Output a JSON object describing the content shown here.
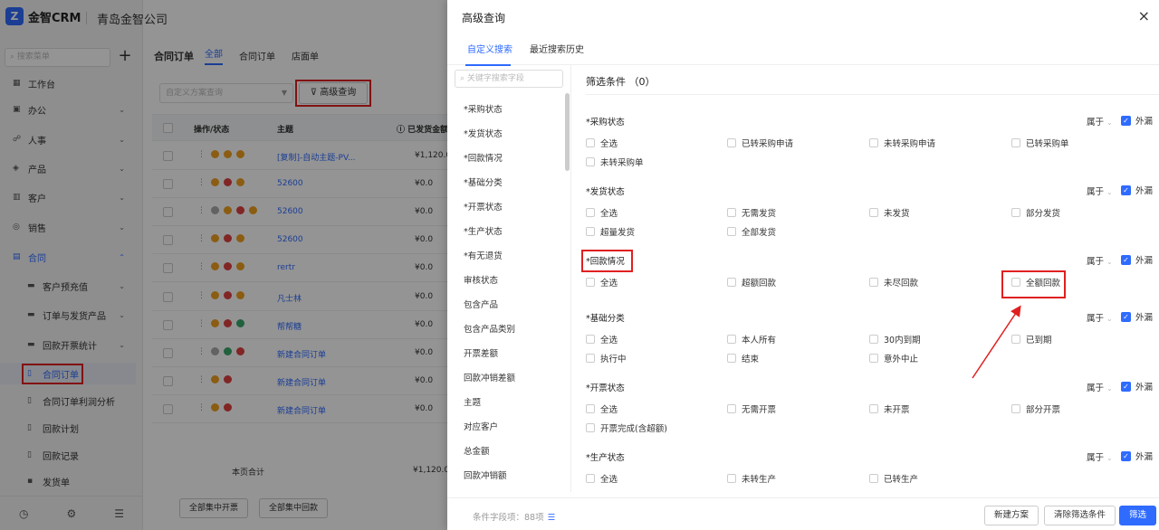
{
  "app": {
    "logo_mark": "Z",
    "logo_text": "金智CRM",
    "company": "青岛金智公司"
  },
  "sidebar": {
    "search_placeholder": "搜索菜单",
    "add_label": "+",
    "items": [
      {
        "label": "工作台",
        "icon": "dashboard-icon"
      },
      {
        "label": "办公",
        "icon": "office-icon"
      },
      {
        "label": "人事",
        "icon": "people-icon"
      },
      {
        "label": "产品",
        "icon": "cube-icon"
      },
      {
        "label": "客户",
        "icon": "chart-icon"
      },
      {
        "label": "销售",
        "icon": "target-icon"
      },
      {
        "label": "合同",
        "icon": "contract-icon"
      }
    ],
    "sub_items": [
      {
        "label": "客户预充值"
      },
      {
        "label": "订单与发货产品"
      },
      {
        "label": "回款开票统计"
      },
      {
        "label": "合同订单"
      },
      {
        "label": "合同订单利润分析"
      },
      {
        "label": "回款计划"
      },
      {
        "label": "回款记录"
      },
      {
        "label": "发货单"
      }
    ],
    "bottom_icons": [
      "clock-icon",
      "tools-icon",
      "menu-collapse-icon"
    ]
  },
  "main": {
    "title": "合同订单",
    "tabs": [
      "全部",
      "合同订单",
      "店面单"
    ],
    "scheme_placeholder": "自定义方案查询",
    "advanced_button": "高级查询",
    "columns": [
      "操作/状态",
      "主题",
      "ⓘ 已发货金额"
    ],
    "rows": [
      {
        "subject": "[复制]-自动主题-PV...",
        "amount": "¥1,120.0"
      },
      {
        "subject": "52600",
        "amount": "¥0.0"
      },
      {
        "subject": "52600",
        "amount": "¥0.0"
      },
      {
        "subject": "52600",
        "amount": "¥0.0"
      },
      {
        "subject": "rertr",
        "amount": "¥0.0"
      },
      {
        "subject": "凡士林",
        "amount": "¥0.0"
      },
      {
        "subject": "帮帮糖",
        "amount": "¥0.0"
      },
      {
        "subject": "新建合同订单",
        "amount": "¥0.0"
      },
      {
        "subject": "新建合同订单",
        "amount": "¥0.0"
      },
      {
        "subject": "新建合同订单",
        "amount": "¥0.0"
      }
    ],
    "page_total_label": "本页合计",
    "page_total_amount": "¥1,120.0",
    "footer_buttons": [
      "全部集中开票",
      "全部集中回款"
    ]
  },
  "drawer": {
    "title": "高级查询",
    "close": "×",
    "tabs": [
      "自定义搜索",
      "最近搜索历史"
    ],
    "field_search_placeholder": "关键字搜索字段",
    "fields": [
      "*采购状态",
      "*发货状态",
      "*回款情况",
      "*基础分类",
      "*开票状态",
      "*生产状态",
      "*有无退货",
      "审核状态",
      "包含产品",
      "包含产品类别",
      "开票差额",
      "回款冲销差额",
      "主题",
      "对应客户",
      "总金额",
      "回款冲销额"
    ],
    "conditions_title": "筛选条件 （0）",
    "relation_label": "属于",
    "outer_label": "外漏",
    "groups": [
      {
        "title": "*采购状态",
        "options": [
          "全选",
          "已转采购申请",
          "未转采购申请",
          "已转采购单",
          "未转采购单"
        ]
      },
      {
        "title": "*发货状态",
        "options": [
          "全选",
          "无需发货",
          "未发货",
          "部分发货",
          "超量发货",
          "全部发货"
        ]
      },
      {
        "title": "*回款情况",
        "options": [
          "全选",
          "超额回款",
          "未尽回款",
          "全额回款"
        ]
      },
      {
        "title": "*基础分类",
        "options": [
          "全选",
          "本人所有",
          "30内到期",
          "已到期",
          "执行中",
          "结束",
          "意外中止"
        ]
      },
      {
        "title": "*开票状态",
        "options": [
          "全选",
          "无需开票",
          "未开票",
          "部分开票",
          "开票完成(含超额)"
        ]
      },
      {
        "title": "*生产状态",
        "options": [
          "全选",
          "未转生产",
          "已转生产"
        ]
      }
    ],
    "footer": {
      "count_label": "条件字段项：88项",
      "buttons": [
        "新建方案",
        "清除筛选条件",
        "筛选"
      ]
    }
  }
}
